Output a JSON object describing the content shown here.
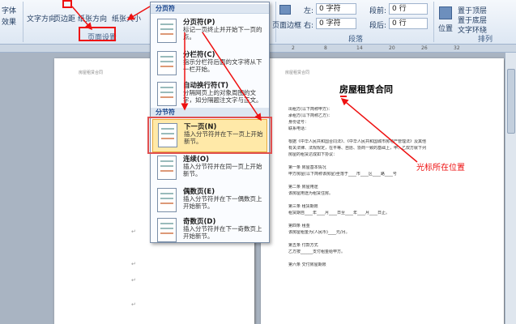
{
  "ribbon": {
    "font_label": "字体",
    "effect_label": "效果",
    "text_direction": "文字方向",
    "margins": "页边距",
    "orientation": "纸张方向",
    "size": "纸张大小",
    "page_setup_group": "页面设置",
    "indent_left_label": "左:",
    "indent_left_value": "0 字符",
    "indent_right_label": "右:",
    "indent_right_value": "0 字符",
    "spacing_before_label": "段前:",
    "spacing_before_value": "0 行",
    "spacing_after_label": "段后:",
    "spacing_after_value": "0 行",
    "paragraph_group": "段落",
    "page_border": "页面边框",
    "position": "位置",
    "bring_forward": "置于顶层",
    "send_back": "置于底层",
    "wrap_text": "文字环绕",
    "arrange_group": "排列"
  },
  "break_menu": {
    "page_breaks_header": "分页符",
    "section_breaks_header": "分节符",
    "items": [
      {
        "title": "分页符(P)",
        "desc": "标记一页终止并开始下一页的点。"
      },
      {
        "title": "分栏符(C)",
        "desc": "指示分栏符后面的文字将从下一栏开始。"
      },
      {
        "title": "自动换行符(T)",
        "desc": "分隔网页上的对象周围的文字，如分隔题注文字与正文。"
      },
      {
        "title": "下一页(N)",
        "desc": "插入分节符并在下一页上开始新节。"
      },
      {
        "title": "连续(O)",
        "desc": "插入分节符并在同一页上开始新节。"
      },
      {
        "title": "偶数页(E)",
        "desc": "插入分节符并在下一偶数页上开始新节。"
      },
      {
        "title": "奇数页(D)",
        "desc": "插入分节符并在下一奇数页上开始新节。"
      }
    ]
  },
  "document": {
    "header_left": "房屋租赁合同",
    "header_right": "房屋租赁合同",
    "title": "房屋租赁合同",
    "lines": [
      "出租方(以下简称甲方)：",
      "承租方(以下简称乙方)：",
      "身份证号：",
      "联系电话：",
      "根据《中华人民共和国合同法》、《中华人民共和国城市房地产管理法》及其他",
      "有关法律、法规规定，在平等、自愿、协商一致的基础上，甲、乙双方就下列",
      "房屋的租赁达成如下协议：",
      "第一条 房屋基本情况",
      "甲方房屋(以下简称该房屋)坐落于____市____区____路____号",
      "第二条 房屋用途",
      "该房屋用途为租赁住房。",
      "第三条 租赁期限",
      "租赁期自____年____月____日至____年____月____日止。",
      "第四条 租金",
      "该房屋租金为(人民币)____元/月。",
      "第五条 付款方式",
      "乙方按______支付租金给甲方。",
      "第六条 交付房屋期限"
    ]
  },
  "annotation": {
    "cursor_note": "光标所在位置"
  },
  "colors": {
    "highlight": "#e11111",
    "selected_item_bg": "#ffe9a8"
  }
}
